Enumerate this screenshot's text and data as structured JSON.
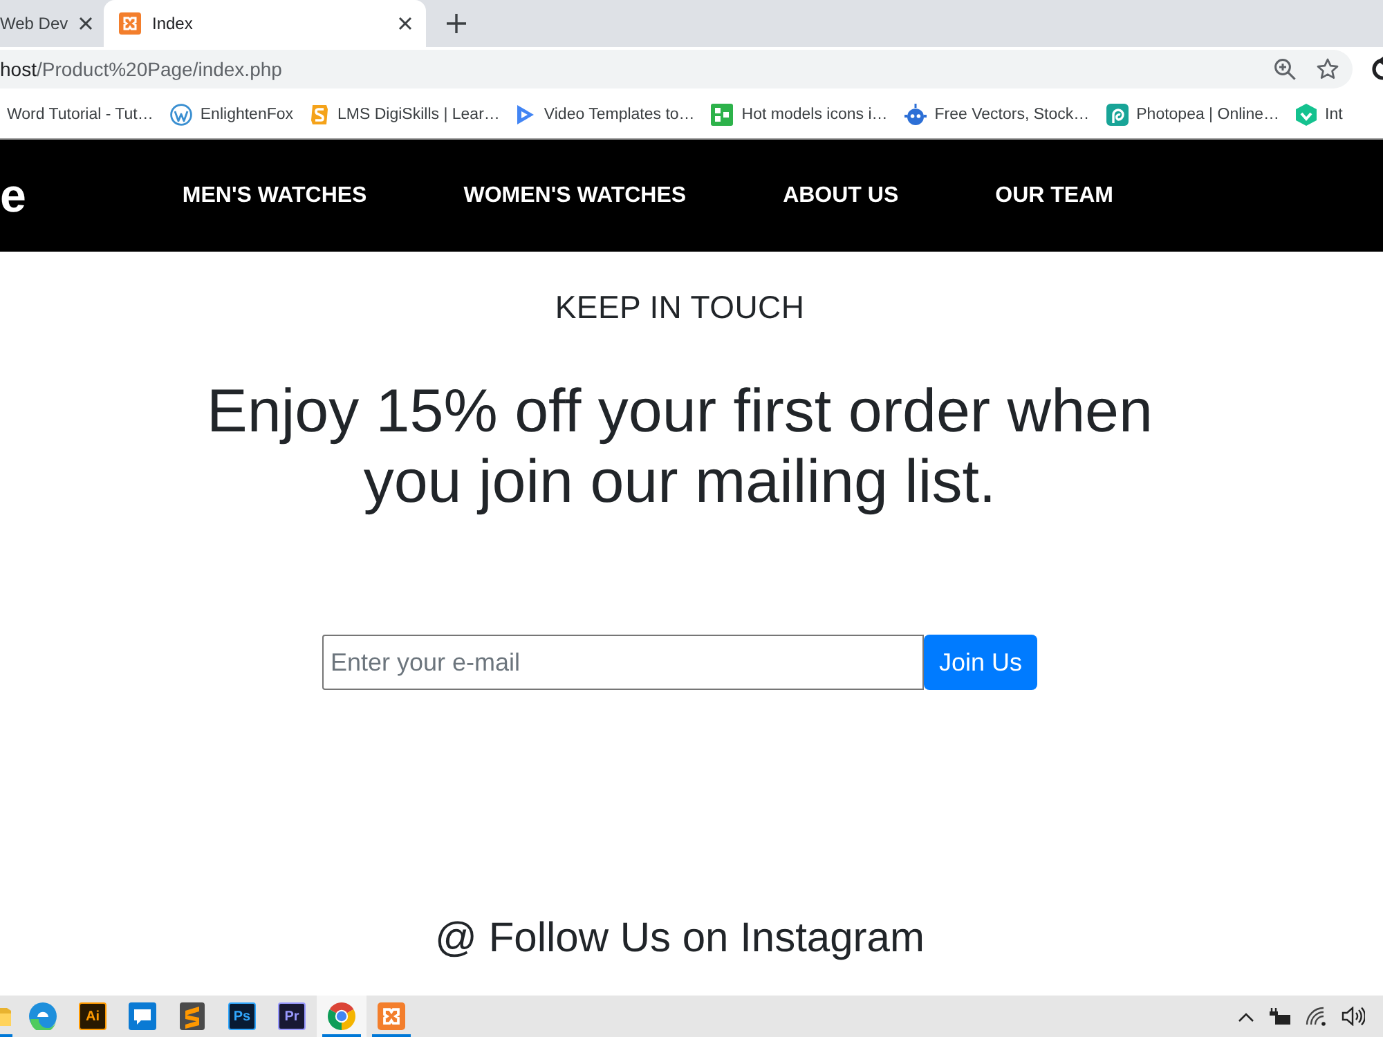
{
  "browser": {
    "tabs": [
      {
        "title": "Web Dev",
        "selected": false,
        "kind": "plain"
      },
      {
        "title": "Index",
        "selected": true,
        "kind": "frame"
      }
    ],
    "address": {
      "host": "host",
      "path": "/Product%20Page/index.php"
    },
    "bookmarks": [
      {
        "label": "Word Tutorial - Tut…",
        "kind": "plain"
      },
      {
        "label": "EnlightenFox",
        "kind": "globe"
      },
      {
        "label": "LMS DigiSkills | Lear…",
        "kind": "stile"
      },
      {
        "label": "Video Templates to…",
        "kind": "play"
      },
      {
        "label": "Hot models icons i…",
        "kind": "grid"
      },
      {
        "label": "Free Vectors, Stock…",
        "kind": "robot"
      },
      {
        "label": "Photopea | Online…",
        "kind": "spiral"
      },
      {
        "label": "Int",
        "kind": "hexagon"
      }
    ]
  },
  "site": {
    "logo": "e",
    "nav": [
      "MEN'S WATCHES",
      "WOMEN'S WATCHES",
      "ABOUT US",
      "OUR TEAM"
    ],
    "subheading": "KEEP IN TOUCH",
    "headline": "Enjoy 15% off your first order when you join our mailing list.",
    "signup": {
      "placeholder": "Enter your e-mail",
      "button": "Join Us"
    },
    "instagram": "@ Follow Us on Instagram"
  },
  "taskbar": {
    "apps": [
      {
        "kind": "folder",
        "open": true,
        "active": false
      },
      {
        "kind": "swirl",
        "open": false,
        "active": false
      },
      {
        "kind": "lettered",
        "label": "Ai",
        "color": "#ff9a00",
        "open": false,
        "active": false
      },
      {
        "kind": "chat",
        "open": false,
        "active": false
      },
      {
        "kind": "stripes",
        "open": false,
        "active": false
      },
      {
        "kind": "lettered",
        "label": "Ps",
        "color": "#31a8ff",
        "open": false,
        "active": false
      },
      {
        "kind": "lettered",
        "label": "Pr",
        "color": "#9999ff",
        "open": false,
        "active": false
      },
      {
        "kind": "ring",
        "open": true,
        "active": true
      },
      {
        "kind": "frame",
        "open": true,
        "active": false
      }
    ]
  }
}
